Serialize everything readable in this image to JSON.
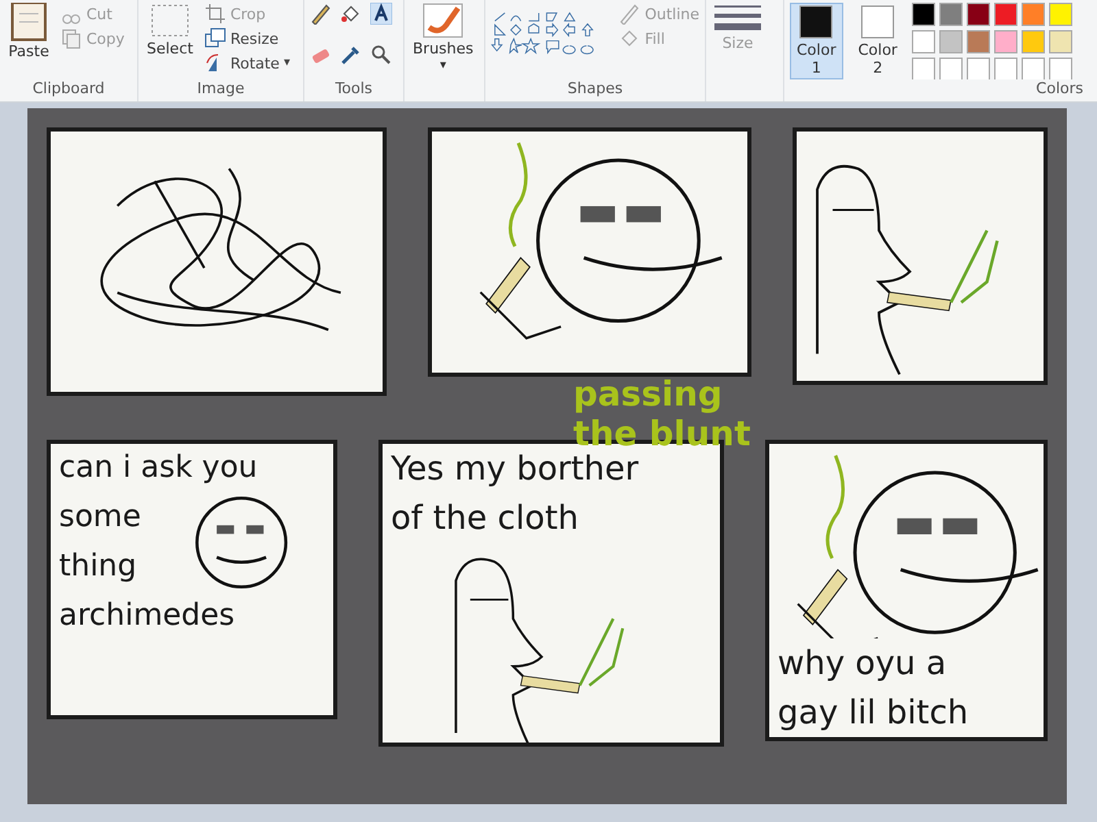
{
  "ribbon": {
    "clipboard": {
      "paste": "Paste",
      "cut": "Cut",
      "copy": "Copy",
      "label": "Clipboard"
    },
    "image": {
      "select": "Select",
      "crop": "Crop",
      "resize": "Resize",
      "rotate": "Rotate",
      "rotate_caret": "▾",
      "label": "Image"
    },
    "tools": {
      "label": "Tools"
    },
    "brushes": {
      "label": "Brushes",
      "caret": "▾"
    },
    "shapes": {
      "outline": "Outline",
      "fill": "Fill",
      "label": "Shapes"
    },
    "size": {
      "label": "Size"
    },
    "color_slots": [
      {
        "name": "Color",
        "number": "1",
        "selected": true,
        "color": "#111111"
      },
      {
        "name": "Color",
        "number": "2",
        "selected": false,
        "color": "#ffffff"
      }
    ],
    "palette": [
      {
        "color": "#000000"
      },
      {
        "color": "#7f7f7f"
      },
      {
        "color": "#880015"
      },
      {
        "color": "#ed1c24"
      },
      {
        "color": "#ff7f27"
      },
      {
        "color": "#fff200"
      },
      {
        "color": "#ffffff"
      },
      {
        "color": "#c3c3c3"
      },
      {
        "color": "#b97a57"
      },
      {
        "color": "#ffaec9"
      },
      {
        "color": "#ffc90e"
      },
      {
        "color": "#efe4b0"
      },
      {
        "color": "#ffffff"
      },
      {
        "color": "#ffffff"
      },
      {
        "color": "#ffffff"
      },
      {
        "color": "#ffffff"
      },
      {
        "color": "#ffffff"
      },
      {
        "color": "#ffffff"
      }
    ],
    "colors_label": "Colors"
  },
  "comic": {
    "panels": [
      {
        "kind": "scribble"
      },
      {
        "kind": "smiley"
      },
      {
        "kind": "profile"
      },
      {
        "kind": "face",
        "lines": [
          "can i ask you",
          "some",
          "thing",
          "archimedes"
        ]
      },
      {
        "kind": "profile",
        "lines": [
          "Yes my borther",
          "of the cloth"
        ]
      },
      {
        "kind": "smiley",
        "lines": [
          "why oyu a",
          "gay lil bitch"
        ]
      }
    ],
    "caption": {
      "lines": [
        "passing",
        "the blunt"
      ],
      "color": "#a9c31c"
    }
  }
}
